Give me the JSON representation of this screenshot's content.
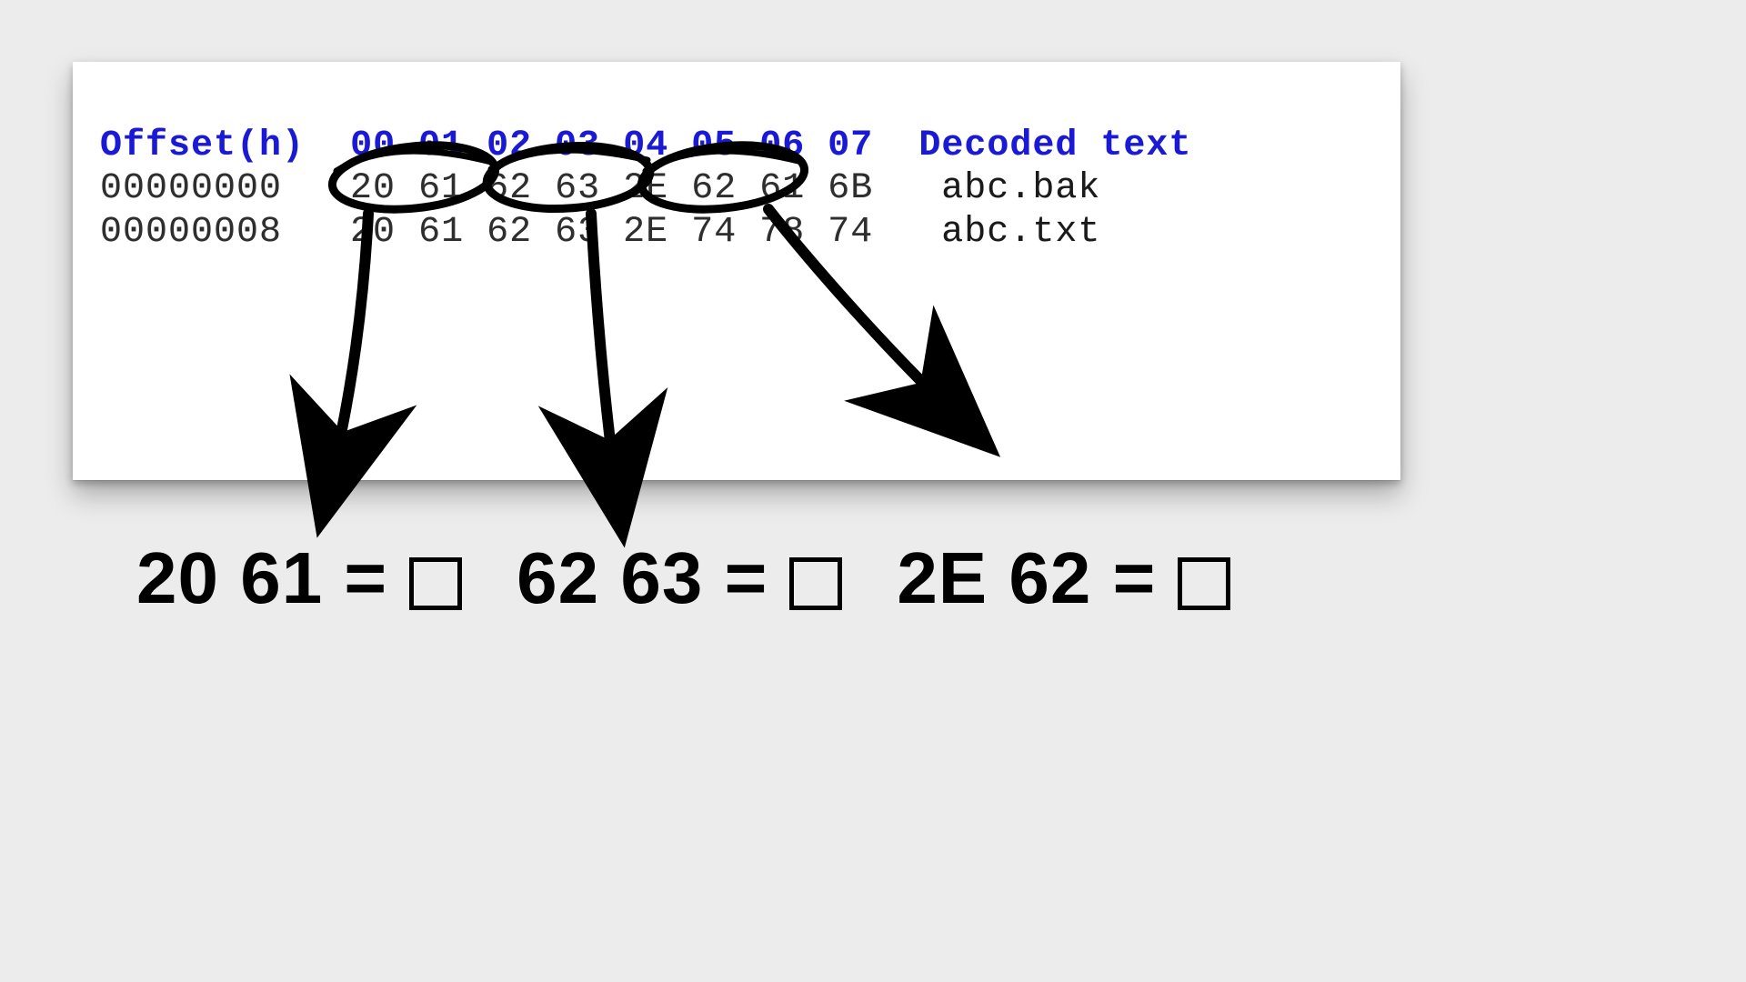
{
  "hex": {
    "header": {
      "offset_label": "Offset(h)",
      "cols": [
        "00",
        "01",
        "02",
        "03",
        "04",
        "05",
        "06",
        "07"
      ],
      "decoded_label": "Decoded text"
    },
    "rows": [
      {
        "offset": "00000000",
        "bytes": [
          "20",
          "61",
          "62",
          "63",
          "2E",
          "62",
          "61",
          "6B"
        ],
        "decoded": "abc.bak"
      },
      {
        "offset": "00000008",
        "bytes": [
          "20",
          "61",
          "62",
          "63",
          "2E",
          "74",
          "78",
          "74"
        ],
        "decoded": "abc.txt"
      }
    ]
  },
  "annotations": {
    "circled_pairs": [
      {
        "bytes": [
          "20",
          "61"
        ]
      },
      {
        "bytes": [
          "62",
          "63"
        ]
      },
      {
        "bytes": [
          "2E",
          "62"
        ]
      }
    ]
  },
  "equations": [
    {
      "lhs": "20 61",
      "rhs_placeholder": "□"
    },
    {
      "lhs": "62 63",
      "rhs_placeholder": "□"
    },
    {
      "lhs": "2E 62",
      "rhs_placeholder": "□"
    }
  ]
}
